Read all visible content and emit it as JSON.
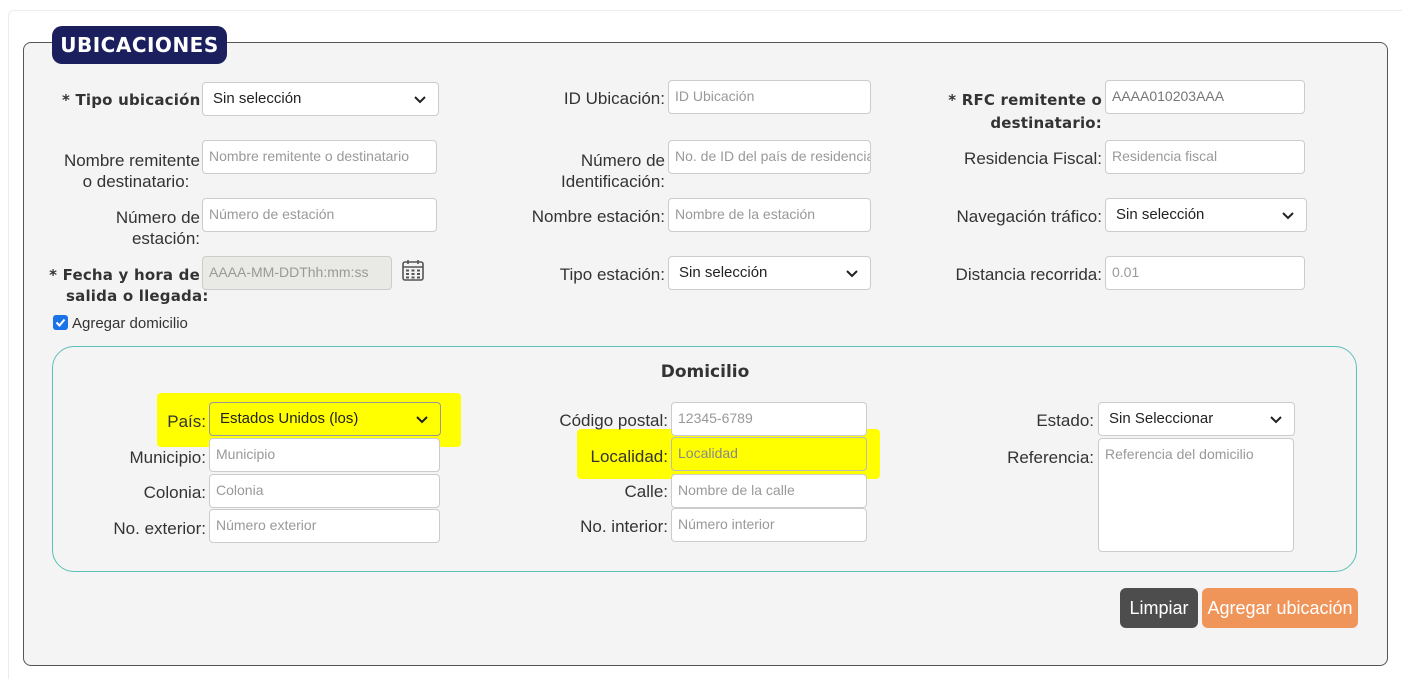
{
  "section_title": "UBICACIONES",
  "form": {
    "tipo_ubicacion": {
      "label": "* Tipo ubicación:",
      "value": "Sin selección"
    },
    "id_ubicacion": {
      "label": "ID Ubicación:",
      "placeholder": "ID Ubicación"
    },
    "rfc": {
      "label_line1": "* RFC remitente o",
      "label_line2": "destinatario:",
      "placeholder": "AAAA010203AAA"
    },
    "nombre_remitente": {
      "label_line1": "Nombre remitente",
      "label_line2": "o destinatario:",
      "placeholder": "Nombre remitente o destinatario"
    },
    "numero_identificacion": {
      "label_line1": "Número de",
      "label_line2": "Identificación:",
      "placeholder": "No. de ID del país de residencia"
    },
    "residencia_fiscal": {
      "label": "Residencia Fiscal:",
      "placeholder": "Residencia fiscal"
    },
    "numero_estacion": {
      "label_line1": "Número de",
      "label_line2": "estación:",
      "placeholder": "Número de estación"
    },
    "nombre_estacion": {
      "label": "Nombre estación:",
      "placeholder": "Nombre de la estación"
    },
    "navegacion_trafico": {
      "label": "Navegación tráfico:",
      "value": "Sin selección"
    },
    "fecha_hora": {
      "label_line1": "* Fecha y hora de",
      "label_line2": "salida o llegada:",
      "placeholder": "AAAA-MM-DDThh:mm:ss",
      "icon": "calendar-icon"
    },
    "tipo_estacion": {
      "label": "Tipo estación:",
      "value": "Sin selección"
    },
    "distancia_recorrida": {
      "label": "Distancia recorrida:",
      "placeholder": "0.01"
    },
    "agregar_domicilio": {
      "label": "Agregar domicilio",
      "checked": true
    }
  },
  "domicilio": {
    "title": "Domicilio",
    "pais": {
      "label": "País:",
      "value": "Estados Unidos (los)"
    },
    "codigo_postal": {
      "label": "Código postal:",
      "placeholder": "12345-6789"
    },
    "estado": {
      "label": "Estado:",
      "value": "Sin Seleccionar"
    },
    "municipio": {
      "label": "Municipio:",
      "placeholder": "Municipio"
    },
    "localidad": {
      "label": "Localidad:",
      "placeholder": "Localidad"
    },
    "referencia": {
      "label": "Referencia:",
      "placeholder": "Referencia del domicilio"
    },
    "colonia": {
      "label": "Colonia:",
      "placeholder": "Colonia"
    },
    "calle": {
      "label": "Calle:",
      "placeholder": "Nombre de la calle"
    },
    "no_exterior": {
      "label": "No. exterior:",
      "placeholder": "Número exterior"
    },
    "no_interior": {
      "label": "No. interior:",
      "placeholder": "Número interior"
    }
  },
  "buttons": {
    "clear": "Limpiar",
    "add": "Agregar ubicación"
  },
  "colors": {
    "legend_bg": "#1b1f5e",
    "highlight": "#ffff00",
    "add_button": "#f0955a",
    "clear_button": "#4d4d4d",
    "domicilio_border": "#5bc0b5"
  }
}
